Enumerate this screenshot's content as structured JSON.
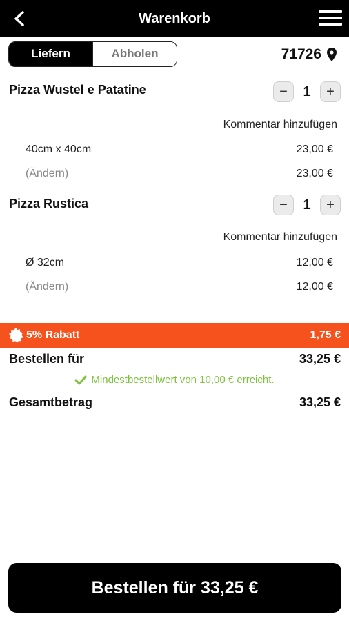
{
  "header": {
    "title": "Warenkorb"
  },
  "delivery_toggle": {
    "options": [
      "Liefern",
      "Abholen"
    ],
    "selected": "Liefern"
  },
  "zip_code": "71726",
  "items": [
    {
      "name": "Pizza Wustel e Patatine",
      "quantity": "1",
      "comment_link": "Kommentar hinzufügen",
      "size": "40cm x 40cm",
      "size_price": "23,00 €",
      "change_label": "(Ändern)",
      "total": "23,00 €"
    },
    {
      "name": "Pizza Rustica",
      "quantity": "1",
      "comment_link": "Kommentar hinzufügen",
      "size": "Ø 32cm",
      "size_price": "12,00 €",
      "change_label": "(Ändern)",
      "total": "12,00 €"
    }
  ],
  "stepper_symbols": {
    "minus": "−",
    "plus": "+"
  },
  "discount": {
    "label": "5% Rabatt",
    "amount": "1,75 €",
    "color": "#f5521e"
  },
  "order_for": {
    "label": "Bestellen für",
    "amount": "33,25 €"
  },
  "min_order_note": "Mindestbestellwert von 10,00 € erreicht.",
  "total": {
    "label": "Gesamtbetrag",
    "amount": "33,25 €"
  },
  "order_button": "Bestellen für 33,25 €",
  "colors": {
    "accent": "#f5521e",
    "success": "#7cc23a",
    "primary": "#000000"
  },
  "icons": [
    "back-arrow-icon",
    "hamburger-menu-icon",
    "location-pin-icon",
    "discount-badge-icon",
    "checkmark-icon"
  ]
}
